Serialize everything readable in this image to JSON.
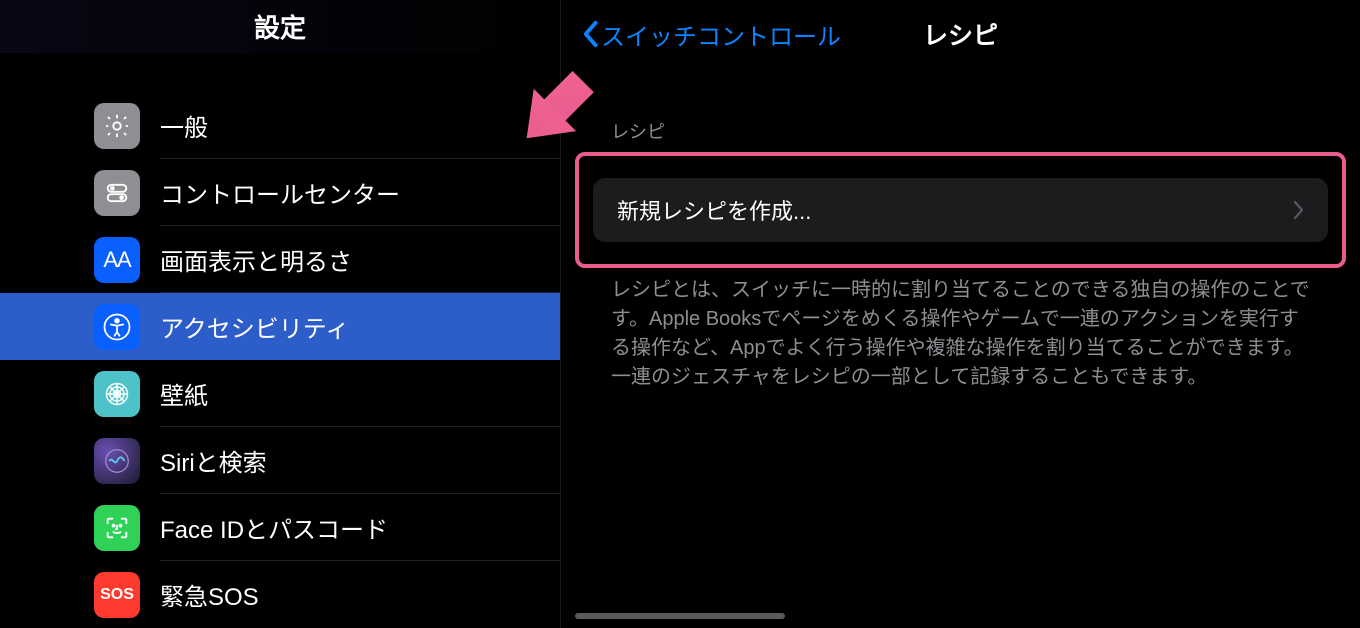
{
  "sidebar": {
    "title": "設定",
    "items": [
      {
        "label": "一般",
        "icon": "general"
      },
      {
        "label": "コントロールセンター",
        "icon": "control-center"
      },
      {
        "label": "画面表示と明るさ",
        "icon": "display"
      },
      {
        "label": "アクセシビリティ",
        "icon": "accessibility",
        "selected": true
      },
      {
        "label": "壁紙",
        "icon": "wallpaper"
      },
      {
        "label": "Siriと検索",
        "icon": "siri"
      },
      {
        "label": "Face IDとパスコード",
        "icon": "faceid"
      },
      {
        "label": "緊急SOS",
        "icon": "sos"
      }
    ]
  },
  "content": {
    "back_label": "スイッチコントロール",
    "title": "レシピ",
    "section_label": "レシピ",
    "create_recipe_label": "新規レシピを作成...",
    "description": "レシピとは、スイッチに一時的に割り当てることのできる独自の操作のことです。Apple Booksでページをめくる操作やゲームで一連のアクションを実行する操作など、Appでよく行う操作や複雑な操作を割り当てることができます。一連のジェスチャをレシピの一部として記録することもできます。"
  },
  "annotation": {
    "arrow_color": "#e85c8f"
  }
}
